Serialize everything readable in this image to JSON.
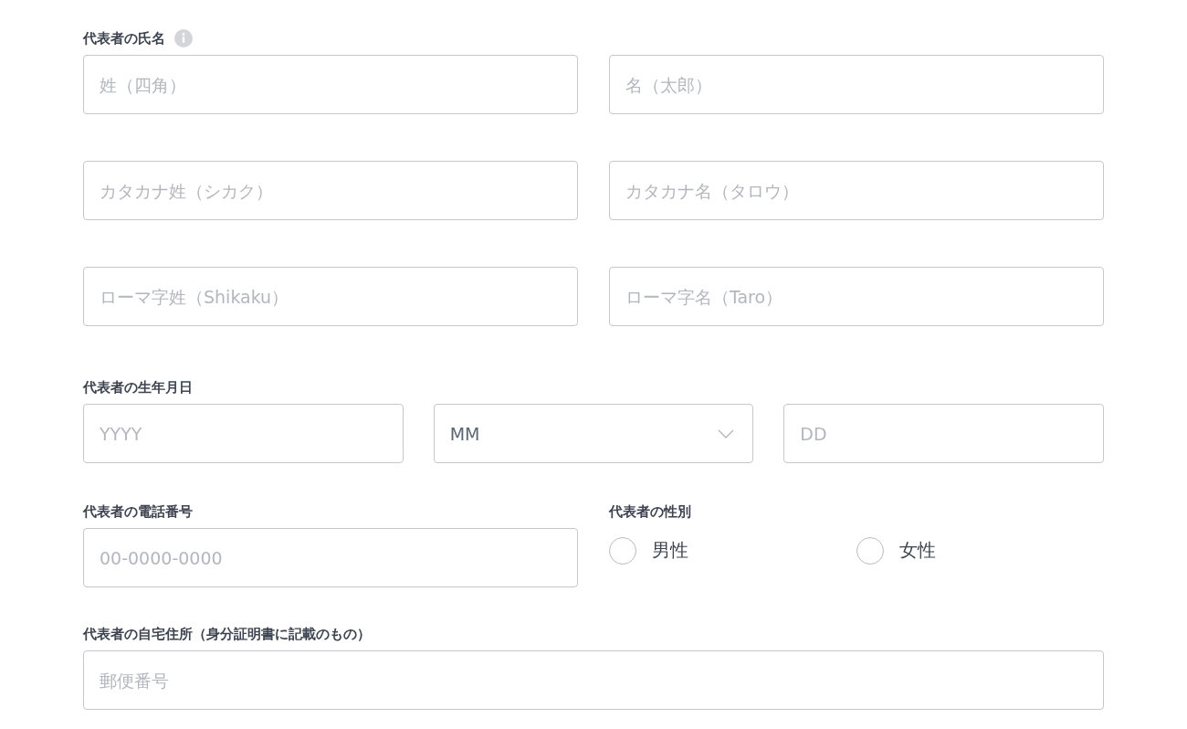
{
  "name_section": {
    "label": "代表者の氏名",
    "fields": [
      {
        "placeholder": "姓（四角）"
      },
      {
        "placeholder": "名（太郎）"
      },
      {
        "placeholder": "カタカナ姓（シカク）"
      },
      {
        "placeholder": "カタカナ名（タロウ）"
      },
      {
        "placeholder": "ローマ字姓（Shikaku）"
      },
      {
        "placeholder": "ローマ字名（Taro）"
      }
    ]
  },
  "birthdate": {
    "label": "代表者の生年月日",
    "year": {
      "placeholder": "YYYY"
    },
    "month": {
      "value": "MM"
    },
    "day": {
      "placeholder": "DD"
    }
  },
  "phone": {
    "label": "代表者の電話番号",
    "placeholder": "00-0000-0000"
  },
  "gender": {
    "label": "代表者の性別",
    "options": [
      {
        "label": "男性",
        "selected": false
      },
      {
        "label": "女性",
        "selected": false
      }
    ]
  },
  "address": {
    "label": "代表者の自宅住所（身分証明書に記載のもの）",
    "placeholder": "郵便番号"
  }
}
